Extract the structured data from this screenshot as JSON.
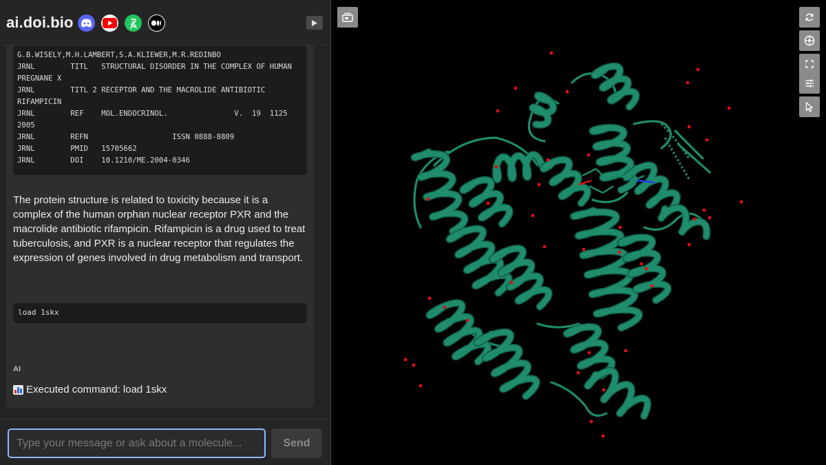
{
  "header": {
    "brand": "ai.doi.bio",
    "social_icons": [
      "discord-icon",
      "youtube-icon",
      "biorxiv-icon",
      "medium-icon"
    ],
    "toggle_icon": "play-icon"
  },
  "message": {
    "pdb_lines": [
      "G.B.WISELY,M.H.LAMBERT,S.A.KLIEWER,M.R.REDINBO",
      "JRNL        TITL   STRUCTURAL DISORDER IN THE COMPLEX OF HUMAN",
      "PREGNANE X",
      "JRNL        TITL 2 RECEPTOR AND THE MACROLIDE ANTIBIOTIC",
      "RIFAMPICIN",
      "JRNL        REF    MOL.ENDOCRINOL.               V.  19  1125",
      "2005",
      "JRNL        REFN                   ISSN 0888-8809",
      "JRNL        PMID   15705662",
      "JRNL        DOI    10.1210/ME.2004-0346"
    ],
    "text": "The protein structure is related to toxicity because it is a complex of the human orphan nuclear receptor PXR and the macrolide antibiotic rifampicin. Rifampicin is a drug used to treat tuberculosis, and PXR is a nuclear receptor that regulates the expression of genes involved in drug metabolism and transport.",
    "command": "load 1skx"
  },
  "ai_message": {
    "label": "AI",
    "icon": "bar-chart-emoji-icon",
    "text": "Executed command: load 1skx"
  },
  "footer": {
    "input_placeholder": "Type your message or ask about a molecule...",
    "input_value": "",
    "send_label": "Send"
  },
  "viewer": {
    "background": "#000000",
    "ribbon_color": "#1f8c6d",
    "water_color": "#e01010",
    "tools": [
      "spin-icon",
      "center-icon",
      "fullscreen-icon",
      "settings-sliders-icon",
      "select-cursor-icon"
    ],
    "top_left_tool": "toggle-panel-icon"
  },
  "colors": {
    "input_border": "#8fb9ff",
    "discord": "#5865f2",
    "youtube": "#ff0000",
    "biorxiv": "#22c55e"
  }
}
